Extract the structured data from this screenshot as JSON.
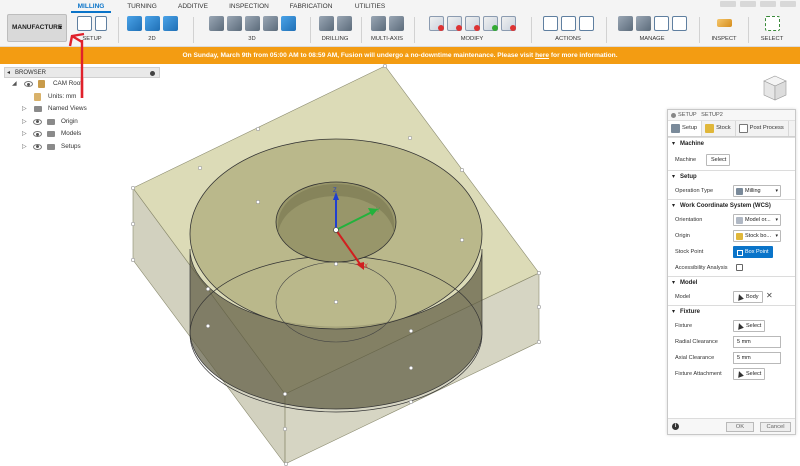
{
  "tabs": [
    "MILLING",
    "TURNING",
    "ADDITIVE",
    "INSPECTION",
    "FABRICATION",
    "UTILITIES"
  ],
  "active_tab": "MILLING",
  "workspace": "MANUFACTURE",
  "ribbon_groups": {
    "setup": "SETUP",
    "twod": "2D",
    "threed": "3D",
    "drilling": "DRILLING",
    "multiaxis": "MULTI-AXIS",
    "modify": "MODIFY",
    "actions": "ACTIONS",
    "manage": "MANAGE",
    "inspect": "INSPECT",
    "select": "SELECT"
  },
  "banner": {
    "text": "On Sunday, March 9th from 05:00 AM to 08:59 AM, Fusion will undergo a no-downtime maintenance. Please visit",
    "link": "here",
    "suffix": "for more information."
  },
  "browser": {
    "title": "BROWSER",
    "items": [
      "CAM Root",
      "Units: mm",
      "Named Views",
      "Origin",
      "Models",
      "Setups"
    ]
  },
  "axes": {
    "z": "Z",
    "y": "Y",
    "x": "X"
  },
  "setup_panel": {
    "title": "SETUP",
    "name": "SETUP2",
    "tabs": [
      "Setup",
      "Stock",
      "Post Process"
    ],
    "sections": {
      "machine": "Machine",
      "setup": "Setup",
      "wcs": "Work Coordinate System (WCS)",
      "model": "Model",
      "fixture": "Fixture"
    },
    "fields": {
      "machine_label": "Machine",
      "machine_value": "Select",
      "operation_type_label": "Operation Type",
      "operation_type_value": "Milling",
      "orientation_label": "Orientation",
      "orientation_value": "Model or...",
      "origin_label": "Origin",
      "origin_value": "Stock bo...",
      "stock_point_label": "Stock Point",
      "stock_point_value": "Box Point",
      "accessibility_label": "Accessibility Analysis",
      "model_label": "Model",
      "model_value": "Body",
      "fixture_label": "Fixture",
      "fixture_value": "Select",
      "radial_clearance_label": "Radial Clearance",
      "radial_clearance_value": "5 mm",
      "axial_clearance_label": "Axial Clearance",
      "axial_clearance_value": "5 mm",
      "fixture_attachment_label": "Fixture Attachment",
      "fixture_attachment_value": "Select"
    },
    "ok": "OK",
    "cancel": "Cancel"
  },
  "colors": {
    "accent": "#0a74c9",
    "banner": "#f39c12",
    "annotation": "#e0212b",
    "stock": "#c9c790",
    "body_side": "#5c5a40"
  }
}
